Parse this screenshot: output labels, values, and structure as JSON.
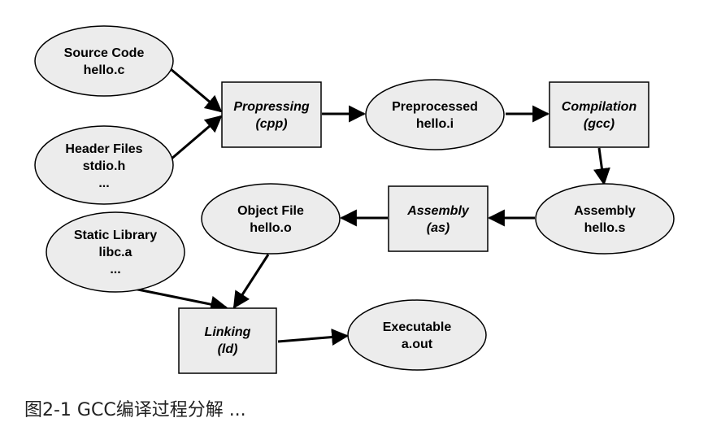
{
  "colors": {
    "node_fill": "#ececec",
    "stroke": "#000000",
    "background": "#ffffff"
  },
  "nodes": {
    "source": [
      "Source Code",
      "hello.c"
    ],
    "header": [
      "Header Files",
      "stdio.h",
      "..."
    ],
    "preprocessing": [
      "Propressing",
      "(cpp)"
    ],
    "preprocessed": [
      "Preprocessed",
      "hello.i"
    ],
    "compilation": [
      "Compilation",
      "(gcc)"
    ],
    "assembly_file": [
      "Assembly",
      "hello.s"
    ],
    "assembly": [
      "Assembly",
      "(as)"
    ],
    "object": [
      "Object File",
      "hello.o"
    ],
    "static_lib": [
      "Static Library",
      "libc.a",
      "..."
    ],
    "linking": [
      "Linking",
      "(ld)"
    ],
    "executable": [
      "Executable",
      "a.out"
    ]
  },
  "caption": "图2-1 GCC编译过程分解 ..."
}
